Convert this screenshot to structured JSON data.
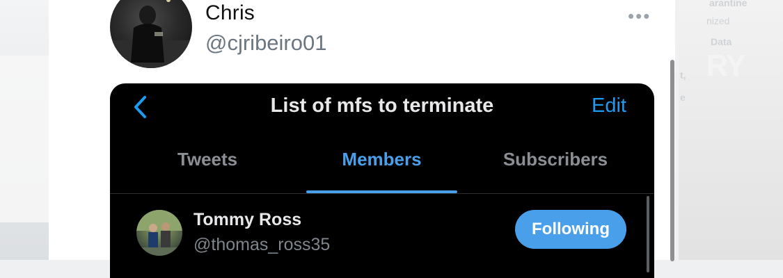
{
  "tweet": {
    "author_name": "Chris",
    "author_handle": "@cjribeiro01",
    "more_icon": "more-horizontal-icon"
  },
  "embedded_screen": {
    "title": "List of mfs to terminate",
    "back_icon": "chevron-left-icon",
    "edit_label": "Edit",
    "tabs": [
      {
        "label": "Tweets",
        "active": false
      },
      {
        "label": "Members",
        "active": true
      },
      {
        "label": "Subscribers",
        "active": false
      }
    ],
    "members": [
      {
        "name": "Tommy Ross",
        "handle": "@thomas_ross35",
        "button_label": "Following"
      }
    ]
  },
  "background": {
    "right_texts": [
      "arantine",
      "nized",
      "Data",
      "RY",
      "t,",
      "e"
    ]
  },
  "colors": {
    "accent_blue": "#1d9bf0",
    "tab_active": "#4a9fea",
    "panel_bg": "#000000",
    "handle_gray": "#6b7680"
  }
}
